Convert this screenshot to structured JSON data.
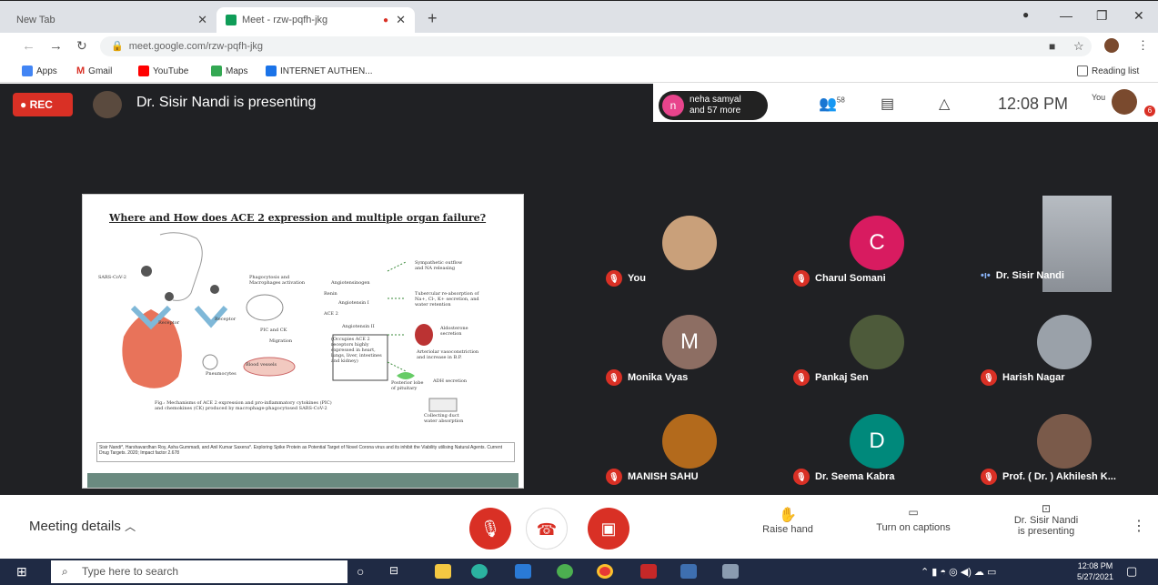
{
  "browser": {
    "tabs": [
      {
        "title": "New Tab"
      },
      {
        "title": "Meet - rzw-pqfh-jkg"
      }
    ],
    "url": "meet.google.com/rzw-pqfh-jkg",
    "bookmarks": [
      "Apps",
      "Gmail",
      "YouTube",
      "Maps",
      "INTERNET AUTHEN..."
    ],
    "reading_list": "Reading list"
  },
  "meet": {
    "rec_label": "REC",
    "presenting_text": "Dr. Sisir Nandi is presenting",
    "participants_chip": {
      "initial": "n",
      "line1": "neha samyal",
      "line2": "and 57 more"
    },
    "participant_count": "58",
    "clock": "12:08 PM",
    "you_label": "You",
    "notification_count": "6",
    "slide": {
      "title": "Where and How does ACE 2 expression and multiple organ failure?",
      "labels": [
        "SARS-CoV-2",
        "Receptor",
        "Receptor",
        "Phagocytosis and Macrophages activation",
        "PIC and CK",
        "Migration",
        "Blood vessels",
        "Pneumocytes",
        "Angiotensinogen",
        "Renin",
        "Angiotensin I",
        "ACE 2",
        "Angiotensin II",
        "(Occupies ACE 2 receptors highly expressed in heart, lungs, liver, intestines and kidney)",
        "Sympathetic outflow and NA releasing",
        "Tubercular re-absorption of Na+, Cl-, K+ secretion, and water retention",
        "Aldosterone secretion",
        "Arteriolar vasoconstriction and increase in B.P.",
        "ADH secretion",
        "Posterior lobe of pituitary",
        "Collecting duct water absorption"
      ],
      "caption": "Fig.: Mechanisms of ACE 2 expression and pro-inflammatory cytokines (PIC) and chemokines (CK) produced by macrophage-phagocytosed SARS-CoV-2",
      "citation": "Sisir Nandi*, Harshavardhan Roy, Asha Gummadi, and Anil Kumar Saxena*. Exploring Spike Protein as Potential Target of Novel Corona virus and its inhibit the Viability utilising Natural Agents. Current Drug Targets. 2020; Impact factor 2.678"
    },
    "tiles": [
      {
        "name": "You",
        "type": "photo",
        "color": "#c9a07a",
        "muted": true
      },
      {
        "name": "Charul Somani",
        "type": "letter",
        "letter": "C",
        "color": "#d81b60",
        "muted": true
      },
      {
        "name": "Dr. Sisir Nandi",
        "type": "video",
        "color": "#8a8f96",
        "muted": false
      },
      {
        "name": "Monika Vyas",
        "type": "letter",
        "letter": "M",
        "color": "#8d6e63",
        "muted": true
      },
      {
        "name": "Pankaj Sen",
        "type": "photo",
        "color": "#4d5a3a",
        "muted": true
      },
      {
        "name": "Harish Nagar",
        "type": "photo",
        "color": "#9aa1a9",
        "muted": true
      },
      {
        "name": "MANISH SAHU",
        "type": "photo",
        "color": "#b36a1c",
        "muted": true
      },
      {
        "name": "Dr. Seema Kabra",
        "type": "letter",
        "letter": "D",
        "color": "#00897b",
        "muted": true
      },
      {
        "name": "Prof. ( Dr. ) Akhilesh K...",
        "type": "photo",
        "color": "#7a5a4a",
        "muted": true
      }
    ],
    "bottom": {
      "meeting_details": "Meeting details",
      "raise_hand": "Raise hand",
      "captions": "Turn on captions",
      "presenting_line1": "Dr. Sisir Nandi",
      "presenting_line2": "is presenting"
    }
  },
  "taskbar": {
    "search_placeholder": "Type here to search",
    "time": "12:08 PM",
    "date": "5/27/2021"
  }
}
